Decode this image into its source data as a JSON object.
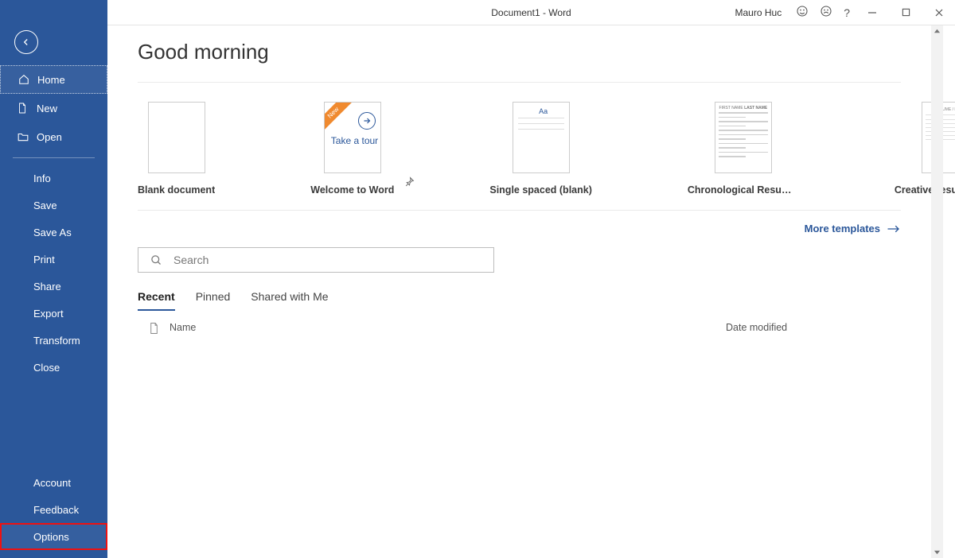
{
  "titlebar": {
    "title": "Document1  -  Word",
    "user": "Mauro Huc"
  },
  "sidebar": {
    "home": "Home",
    "new": "New",
    "open": "Open",
    "info": "Info",
    "save": "Save",
    "save_as": "Save As",
    "print": "Print",
    "share": "Share",
    "export": "Export",
    "transform": "Transform",
    "close": "Close",
    "account": "Account",
    "feedback": "Feedback",
    "options": "Options"
  },
  "main": {
    "greeting": "Good morning",
    "templates": {
      "blank": "Blank document",
      "welcome": "Welcome to Word",
      "welcome_ribbon": "New",
      "welcome_txt": "Take a tour",
      "single": "Single spaced (blank)",
      "single_aa": "Aa",
      "chrono": "Chronological Resume (M…",
      "creative": "Creative resume, designe…"
    },
    "more_templates": "More templates",
    "search_placeholder": "Search",
    "tabs": {
      "recent": "Recent",
      "pinned": "Pinned",
      "shared": "Shared with Me"
    },
    "list": {
      "name": "Name",
      "date": "Date modified"
    }
  }
}
